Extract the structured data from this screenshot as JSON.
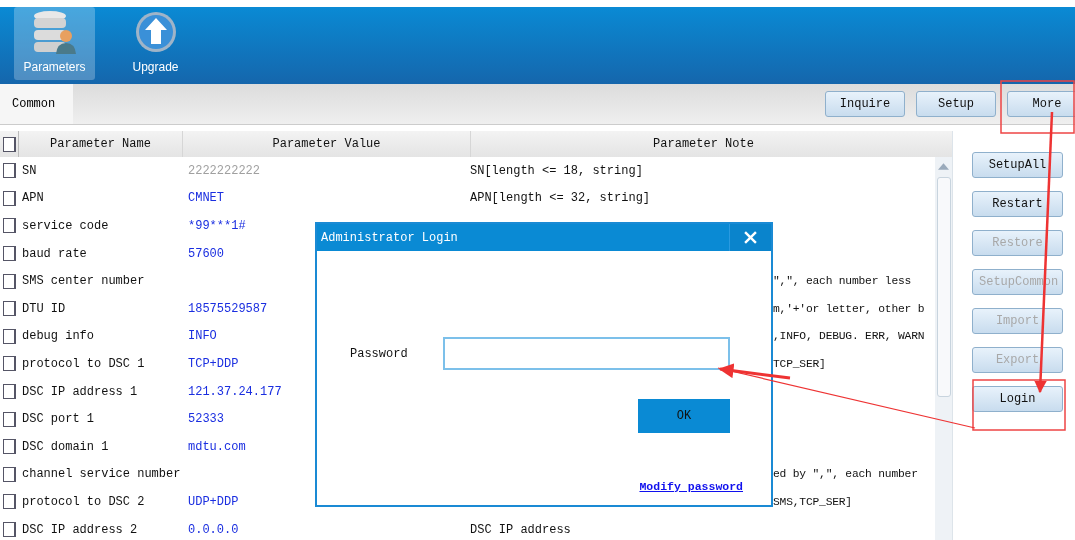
{
  "toolbar": [
    {
      "label": "Parameters",
      "selected": true,
      "kind": "database"
    },
    {
      "label": "Upgrade",
      "selected": false,
      "kind": "upload"
    }
  ],
  "tabs": [
    {
      "label": "Common",
      "selected": true
    }
  ],
  "actions": [
    "Inquire",
    "Setup",
    "More"
  ],
  "table": {
    "columns": [
      "Parameter Name",
      "Parameter Value",
      "Parameter Note"
    ],
    "header_checked": false,
    "rows": [
      {
        "checked": false,
        "name": "SN",
        "value": "2222222222",
        "readonly": true,
        "note": "SN[length <= 18, string]",
        "covered": false
      },
      {
        "checked": false,
        "name": "APN",
        "value": "CMNET",
        "readonly": false,
        "note": "APN[length <= 32, string]",
        "covered": false
      },
      {
        "checked": false,
        "name": "service code",
        "value": "*99***1#",
        "readonly": false
      },
      {
        "checked": false,
        "name": "baud rate",
        "value": "57600",
        "readonly": false
      },
      {
        "checked": false,
        "name": "SMS center number",
        "note": "\",\", each number less",
        "covered": true
      },
      {
        "checked": false,
        "name": "DTU ID",
        "value": "18575529587",
        "readonly": false,
        "note": "m,'+'or letter, other b",
        "covered": true
      },
      {
        "checked": false,
        "name": "debug info",
        "value": "INFO",
        "readonly": false,
        "note": ",INFO, DEBUG. ERR, WARN",
        "covered": true
      },
      {
        "checked": false,
        "name": "protocol to DSC 1",
        "value": "TCP+DDP",
        "readonly": false,
        "note": "TCP_SER]",
        "covered": true
      },
      {
        "checked": false,
        "name": "DSC IP address 1",
        "value": "121.37.24.177",
        "readonly": false
      },
      {
        "checked": false,
        "name": "DSC port 1",
        "value": "52333",
        "readonly": false
      },
      {
        "checked": false,
        "name": "DSC domain 1",
        "value": "mdtu.com",
        "readonly": false
      },
      {
        "checked": false,
        "name": "channel service number",
        "note": "ed by \",\", each number",
        "covered": true
      },
      {
        "checked": false,
        "name": "protocol to DSC 2",
        "value": "UDP+DDP",
        "readonly": false,
        "note": "SMS,TCP_SER]",
        "covered": true
      },
      {
        "checked": false,
        "name": "DSC IP address 2",
        "value": "0.0.0.0",
        "readonly": false,
        "note": "DSC IP address",
        "covered": false
      }
    ]
  },
  "side_buttons": [
    {
      "label": "SetupAll",
      "disabled": false
    },
    {
      "label": "Restart",
      "disabled": false
    },
    {
      "label": "Restore",
      "disabled": true
    },
    {
      "label": "SetupCommon",
      "disabled": true
    },
    {
      "label": "Import",
      "disabled": true
    },
    {
      "label": "Export",
      "disabled": true
    },
    {
      "label": "Login",
      "disabled": false
    }
  ],
  "dialog": {
    "title": "Administrator Login",
    "password_label": "Password",
    "ok": "OK",
    "link": "Modify password"
  }
}
